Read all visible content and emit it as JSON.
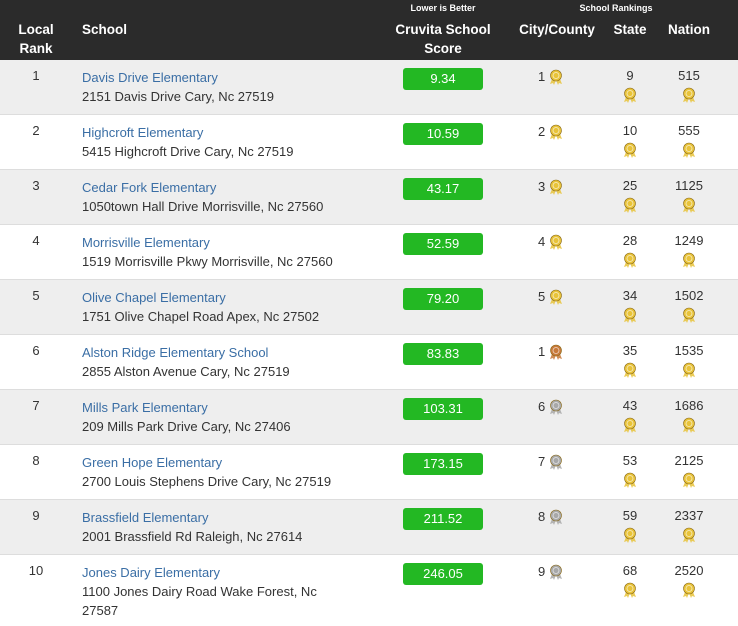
{
  "header": {
    "local_rank": "Local\nRank",
    "local_rank_line1": "Local",
    "local_rank_line2": "Rank",
    "school": "School",
    "lower_is_better": "Lower is Better",
    "score_line1": "Cruvita School",
    "score_line2": "Score",
    "school_rankings": "School Rankings",
    "city_county": "City/County",
    "state": "State",
    "nation": "Nation"
  },
  "colors": {
    "header_bg": "#2b2b2b",
    "score_green": "#23b823",
    "link_blue": "#3a6ea5",
    "medal_gold": "#e8c33a",
    "medal_bronze": "#c8793a",
    "medal_silver": "#a8a8a8"
  },
  "rows": [
    {
      "rank": "1",
      "name": "Davis Drive Elementary",
      "address": "2151 Davis Drive Cary, Nc 27519",
      "score": "9.34",
      "city": "1",
      "city_medal": "gold",
      "state": "9",
      "nation": "515"
    },
    {
      "rank": "2",
      "name": "Highcroft Elementary",
      "address": "5415 Highcroft Drive Cary, Nc 27519",
      "score": "10.59",
      "city": "2",
      "city_medal": "gold",
      "state": "10",
      "nation": "555"
    },
    {
      "rank": "3",
      "name": "Cedar Fork Elementary",
      "address": "1050town Hall Drive Morrisville, Nc 27560",
      "score": "43.17",
      "city": "3",
      "city_medal": "gold",
      "state": "25",
      "nation": "1125"
    },
    {
      "rank": "4",
      "name": "Morrisville Elementary",
      "address": "1519 Morrisville Pkwy Morrisville, Nc 27560",
      "score": "52.59",
      "city": "4",
      "city_medal": "gold",
      "state": "28",
      "nation": "1249"
    },
    {
      "rank": "5",
      "name": "Olive Chapel Elementary",
      "address": "1751 Olive Chapel Road Apex, Nc 27502",
      "score": "79.20",
      "city": "5",
      "city_medal": "gold",
      "state": "34",
      "nation": "1502"
    },
    {
      "rank": "6",
      "name": "Alston Ridge Elementary School",
      "address": "2855 Alston Avenue Cary, Nc 27519",
      "score": "83.83",
      "city": "1",
      "city_medal": "bronze",
      "state": "35",
      "nation": "1535"
    },
    {
      "rank": "7",
      "name": "Mills Park Elementary",
      "address": "209 Mills Park Drive Cary, Nc 27406",
      "score": "103.31",
      "city": "6",
      "city_medal": "silver",
      "state": "43",
      "nation": "1686"
    },
    {
      "rank": "8",
      "name": "Green Hope Elementary",
      "address": "2700 Louis Stephens Drive Cary, Nc 27519",
      "score": "173.15",
      "city": "7",
      "city_medal": "silver",
      "state": "53",
      "nation": "2125"
    },
    {
      "rank": "9",
      "name": "Brassfield Elementary",
      "address": "2001 Brassfield Rd Raleigh, Nc 27614",
      "score": "211.52",
      "city": "8",
      "city_medal": "silver",
      "state": "59",
      "nation": "2337"
    },
    {
      "rank": "10",
      "name": "Jones Dairy Elementary",
      "address_line1": "1100 Jones Dairy Road Wake Forest, Nc",
      "address_line2": "27587",
      "score": "246.05",
      "city": "9",
      "city_medal": "silver",
      "state": "68",
      "nation": "2520"
    }
  ]
}
